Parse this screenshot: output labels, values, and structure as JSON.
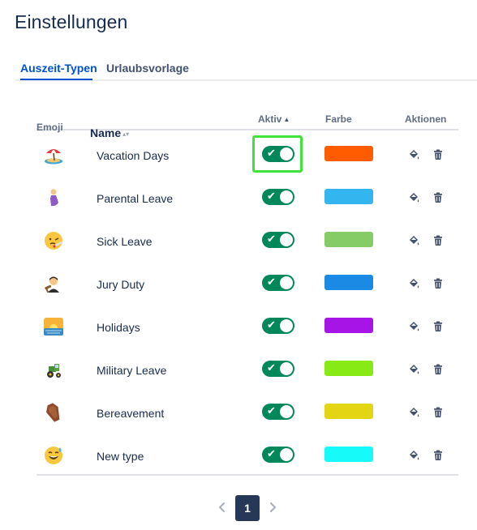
{
  "page": {
    "title": "Einstellungen"
  },
  "tabs": [
    {
      "label": "Auszeit-Typen",
      "active": true
    },
    {
      "label": "Urlaubsvorlage",
      "active": false
    }
  ],
  "table": {
    "headers": {
      "emoji": "Emoji",
      "name": "Name",
      "aktiv": "Aktiv",
      "farbe": "Farbe",
      "aktionen": "Aktionen"
    },
    "rows": [
      {
        "emoji_icon": "beach-umbrella-icon",
        "name": "Vacation Days",
        "active": true,
        "color": "#ff5c00",
        "focused": true
      },
      {
        "emoji_icon": "pregnant-woman-icon",
        "name": "Parental Leave",
        "active": true,
        "color": "#33b5ef"
      },
      {
        "emoji_icon": "face-with-thermometer-icon",
        "name": "Sick Leave",
        "active": true,
        "color": "#85cc66"
      },
      {
        "emoji_icon": "judge-icon",
        "name": "Jury Duty",
        "active": true,
        "color": "#1a8ae5"
      },
      {
        "emoji_icon": "sunrise-icon",
        "name": "Holidays",
        "active": true,
        "color": "#a715e6"
      },
      {
        "emoji_icon": "tractor-icon",
        "name": "Military Leave",
        "active": true,
        "color": "#88ea14"
      },
      {
        "emoji_icon": "coffin-icon",
        "name": "Bereavement",
        "active": true,
        "color": "#e3d414"
      },
      {
        "emoji_icon": "grinning-sweat-icon",
        "name": "New type",
        "active": true,
        "color": "#16fafa"
      }
    ]
  },
  "pagination": {
    "current_page": "1"
  }
}
